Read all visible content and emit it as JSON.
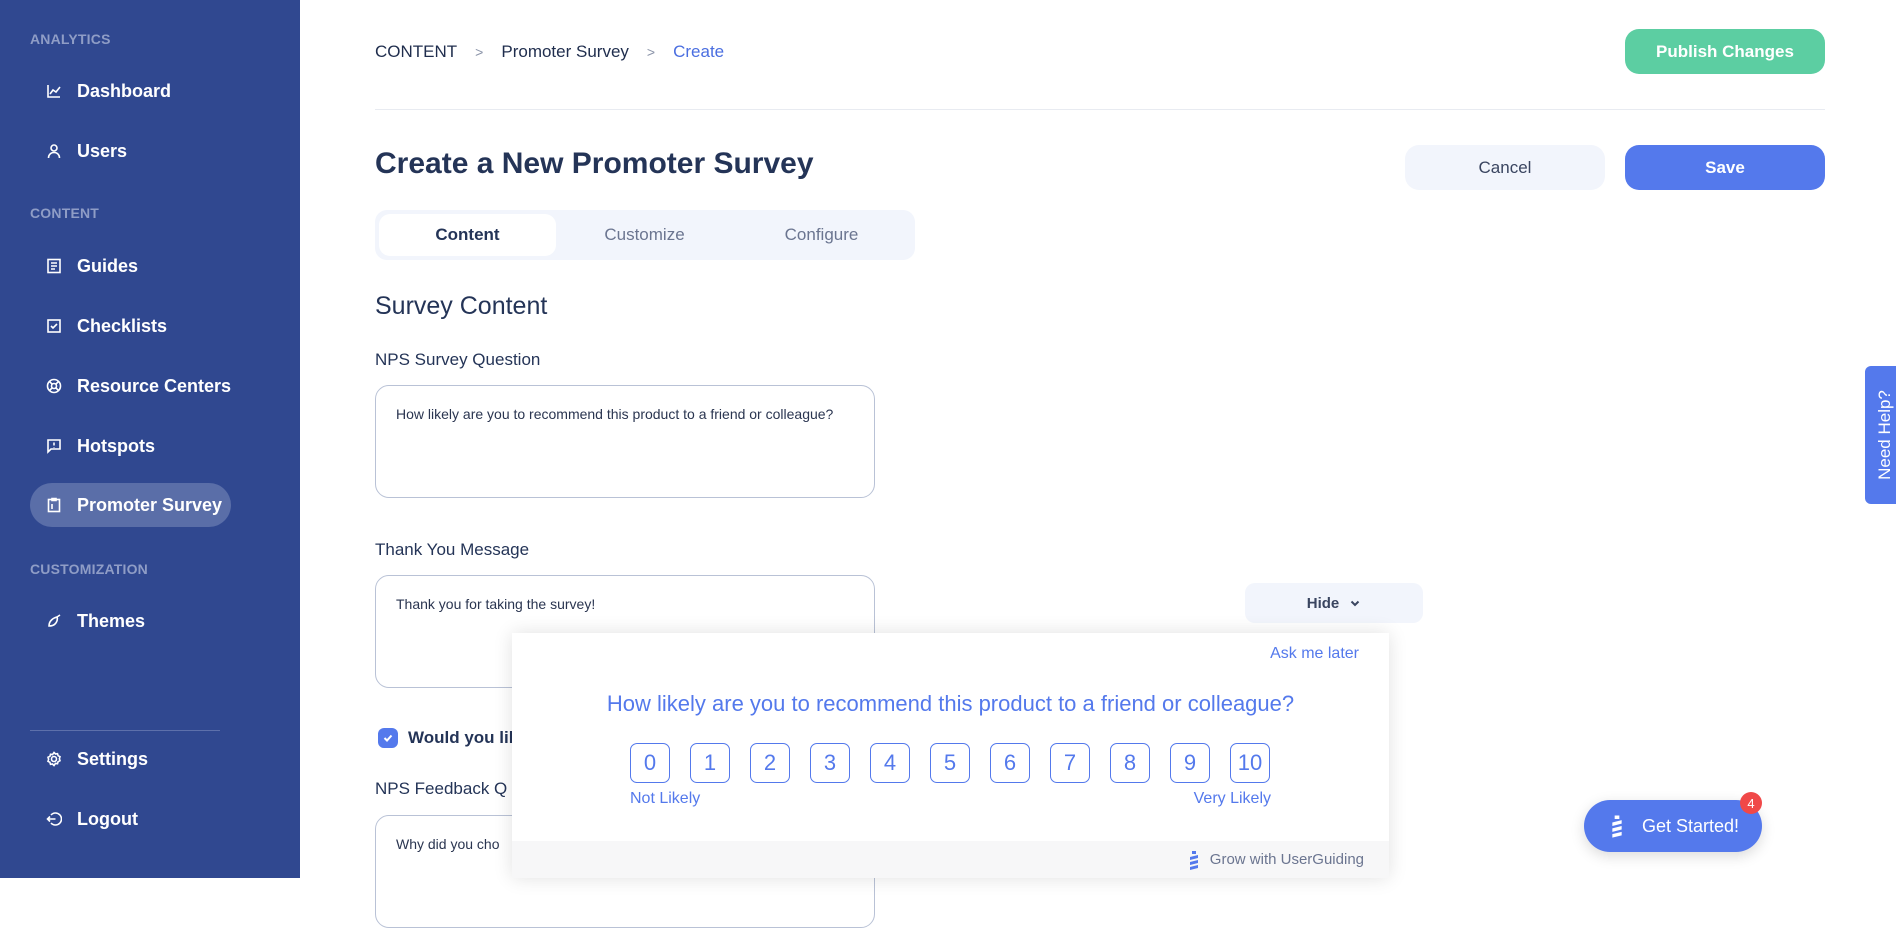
{
  "sidebar": {
    "sections": [
      {
        "label": "ANALYTICS"
      },
      {
        "label": "CONTENT"
      },
      {
        "label": "CUSTOMIZATION"
      }
    ],
    "items": [
      {
        "label": "Dashboard",
        "icon": "chart-line-icon"
      },
      {
        "label": "Users",
        "icon": "user-icon"
      },
      {
        "label": "Guides",
        "icon": "document-icon"
      },
      {
        "label": "Checklists",
        "icon": "checkbox-icon"
      },
      {
        "label": "Resource Centers",
        "icon": "lifebuoy-icon"
      },
      {
        "label": "Hotspots",
        "icon": "message-alert-icon"
      },
      {
        "label": "Promoter Survey",
        "icon": "clipboard-icon",
        "active": true
      },
      {
        "label": "Themes",
        "icon": "brush-icon"
      },
      {
        "label": "Settings",
        "icon": "gear-icon"
      },
      {
        "label": "Logout",
        "icon": "logout-icon"
      }
    ]
  },
  "header": {
    "breadcrumb": [
      "CONTENT",
      "Promoter Survey",
      "Create"
    ],
    "publish_label": "Publish Changes",
    "cancel_label": "Cancel",
    "save_label": "Save",
    "title": "Create a New Promoter Survey"
  },
  "tabs": [
    {
      "label": "Content",
      "active": true
    },
    {
      "label": "Customize"
    },
    {
      "label": "Configure"
    }
  ],
  "form": {
    "section_title": "Survey Content",
    "question_label": "NPS Survey Question",
    "question_value": "How likely are you to recommend this product to a friend or colleague?",
    "thanks_label": "Thank You Message",
    "thanks_value": "Thank you for taking the survey!",
    "feedback_checkbox_label": "Would you lik",
    "feedback_checkbox_checked": true,
    "feedback_label": "NPS Feedback Q",
    "feedback_value": "Why did you cho"
  },
  "preview": {
    "hide_label": "Hide",
    "ask_later": "Ask me later",
    "question": "How likely are you to recommend this product to a friend or colleague?",
    "scores": [
      "0",
      "1",
      "2",
      "3",
      "4",
      "5",
      "6",
      "7",
      "8",
      "9",
      "10"
    ],
    "low_label": "Not Likely",
    "high_label": "Very Likely",
    "footer": "Grow with UserGuiding"
  },
  "widgets": {
    "need_help": "Need Help?",
    "get_started": "Get Started!",
    "get_started_badge": "4"
  },
  "colors": {
    "sidebar": "#304890",
    "accent": "#5479ec",
    "publish": "#5ccea2",
    "badge": "#f04848"
  }
}
